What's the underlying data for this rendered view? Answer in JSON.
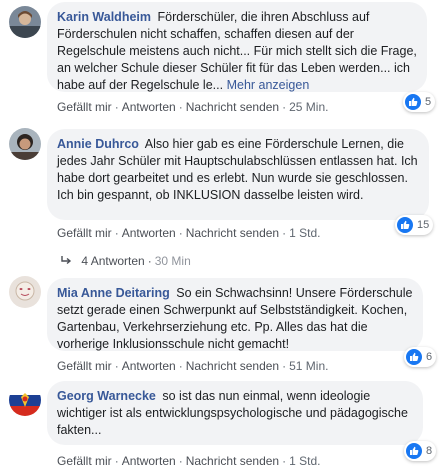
{
  "comments": [
    {
      "author": "Karin Waldheim",
      "text": "Förderschüler, die ihren Abschluss auf Förderschulen nicht schaffen, schaffen diesen auf der Regelschule meistens auch nicht... Für mich stellt sich die Frage, an welcher Schule dieser Schüler fit für das Leben werden... ich habe auf der Regelschule le...",
      "more_link": "Mehr anzeigen",
      "like_label": "Gefällt mir",
      "reply_label": "Antworten",
      "message_label": "Nachricht senden",
      "time": "25 Min.",
      "likes": "5"
    },
    {
      "author": "Annie Duhrco",
      "text": "Also hier gab es eine Förderschule Lernen, die jedes Jahr Schüler mit Hauptschulabschlüssen entlassen hat. Ich habe dort gearbeitet und es erlebt. Nun wurde sie geschlossen. Ich bin gespannt, ob INKLUSION dasselbe leisten wird.",
      "like_label": "Gefällt mir",
      "reply_label": "Antworten",
      "message_label": "Nachricht senden",
      "time": "1 Std.",
      "likes": "15",
      "replies_label": "4 Antworten",
      "replies_time": "30 Min"
    },
    {
      "author": "Mia Anne Deitaring",
      "text": "So ein Schwachsinn! Unsere Förderschule setzt gerade einen Schwerpunkt auf Selbstständigkeit. Kochen, Gartenbau, Verkehrserziehung etc. Pp. Alles das hat die vorherige Inklusionsschule nicht gemacht!",
      "like_label": "Gefällt mir",
      "reply_label": "Antworten",
      "message_label": "Nachricht senden",
      "time": "51 Min.",
      "likes": "6"
    },
    {
      "author": "Georg Warnecke",
      "text": "so ist das nun einmal, wenn ideologie wichtiger ist als entwicklungspsychologische und pädagogische fakten...",
      "like_label": "Gefällt mir",
      "reply_label": "Antworten",
      "message_label": "Nachricht senden",
      "time": "1 Std.",
      "likes": "8"
    }
  ],
  "colors": {
    "author": "#385898",
    "bubble": "#f2f3f5",
    "like_badge": "#1877f2",
    "meta_text": "#606770"
  },
  "icons": {
    "like": "thumbs-up-icon",
    "reply_arrow": "reply-arrow-icon"
  }
}
